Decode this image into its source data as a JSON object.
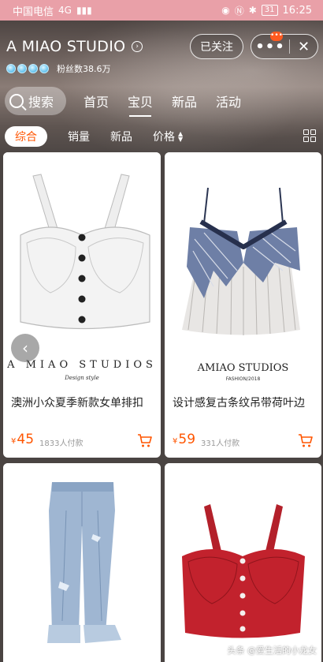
{
  "status_bar": {
    "carrier": "中国电信",
    "network": "4G",
    "time": "16:25",
    "battery": "31"
  },
  "store": {
    "name": "A MIAO STUDIO",
    "fans": "粉丝数38.6万",
    "follow_label": "已关注",
    "more_label": "•••",
    "close_label": "✕",
    "badge": "•••"
  },
  "tabs": {
    "search_label": "搜索",
    "items": [
      "首页",
      "宝贝",
      "新品",
      "活动"
    ],
    "active": "宝贝"
  },
  "filters": {
    "items": [
      "综合",
      "销量",
      "新品",
      "价格"
    ],
    "active": "综合"
  },
  "products": [
    {
      "title": "澳洲小众夏季新款女单排扣",
      "currency": "¥",
      "price": "45",
      "sold": "1833人付款",
      "brand": "A MIAO STUDIOS",
      "brand_sub": "Design style"
    },
    {
      "title": "设计感复古条纹吊带荷叶边",
      "currency": "¥",
      "price": "59",
      "sold": "331人付款",
      "brand": "AMIAO STUDIOS",
      "brand_sub": "FASHION/2018"
    },
    {
      "title": "",
      "currency": "",
      "price": "",
      "sold": ""
    },
    {
      "title": "",
      "currency": "",
      "price": "",
      "sold": ""
    }
  ],
  "watermark": "头条 @爱生活的小龙女",
  "colors": {
    "accent": "#ff5500",
    "status_bar": "#e9a0a8"
  }
}
